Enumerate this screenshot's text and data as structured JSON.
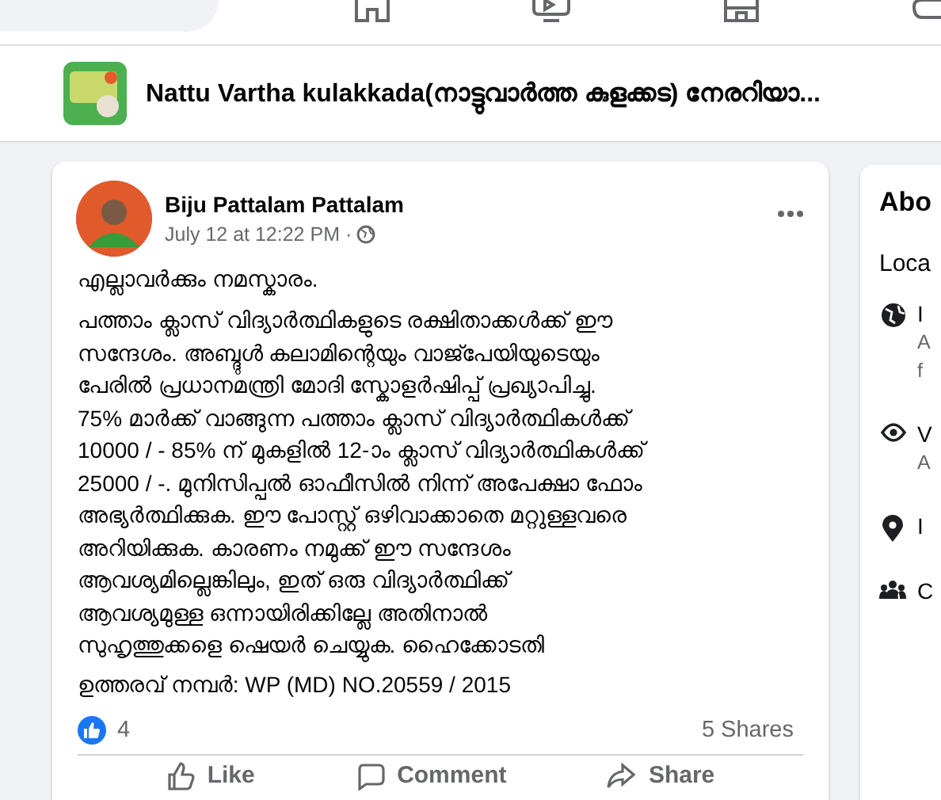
{
  "page_header": {
    "title": "Nattu Vartha kulakkada(നാട്ടുവാർത്ത കുളക്കട) നേരറിയാ..."
  },
  "post": {
    "author": "Biju Pattalam Pattalam",
    "time": "July 12 at 12:22 PM ·",
    "greeting": "എല്ലാവർക്കും നമസ്കാരം.",
    "body_lines": [
      " പത്താം ക്ലാസ് വിദ്യാർത്ഥികളുടെ രക്ഷിതാക്കൾക്ക് ഈ",
      "സന്ദേശം.  അബ്ദുൾ കലാമിന്റെയും വാജ്പേയിയുടെയും",
      "പേരിൽ പ്രധാനമന്ത്രി മോദി സ്കോളർഷിപ്പ് പ്രഖ്യാപിച്ചു.",
      "75% മാർക്ക് വാങ്ങുന്ന പത്താം ക്ലാസ് വിദ്യാർത്ഥികൾക്ക്",
      "10000 / - 85% ന് മുകളിൽ 12-ാം ക്ലാസ് വിദ്യാർത്ഥികൾക്ക്",
      "25000 / -.  മുനിസിപ്പൽ ഓഫീസിൽ നിന്ന് അപേക്ഷാ ഫോം",
      "അഭ്യർത്ഥിക്കുക.  ഈ പോസ്റ്റ് ഒഴിവാക്കാതെ മറ്റുള്ളവരെ",
      "അറിയിക്കുക.  കാരണം നമുക്ക് ഈ സന്ദേശം",
      "ആവശ്യമില്ലെങ്കിലും, ഇത് ഒരു വിദ്യാർത്ഥിക്ക്",
      "ആവശ്യമുള്ള ഒന്നായിരിക്കില്ലേ  അതിനാൽ",
      "സുഹൃത്തുക്കളെ ഷെയർ ചെയ്യുക.  ഹൈക്കോടതി"
    ],
    "order_number": " ഉത്തരവ് നമ്പർ: WP (MD) NO.20559 / 2015",
    "like_count": "4",
    "shares": "5 Shares",
    "actions": [
      {
        "kind": "like",
        "label": "Like"
      },
      {
        "kind": "comment",
        "label": "Comment"
      },
      {
        "kind": "share",
        "label": "Share"
      }
    ]
  },
  "about": {
    "title": "Abo",
    "subtitle": "Loca",
    "items": [
      {
        "kind": "globe",
        "lines": [
          "I",
          "A",
          "f"
        ]
      },
      {
        "kind": "eye",
        "lines": [
          "V",
          "A"
        ]
      },
      {
        "kind": "pin",
        "lines": [
          "I"
        ]
      },
      {
        "kind": "people",
        "lines": [
          "C"
        ]
      }
    ]
  }
}
